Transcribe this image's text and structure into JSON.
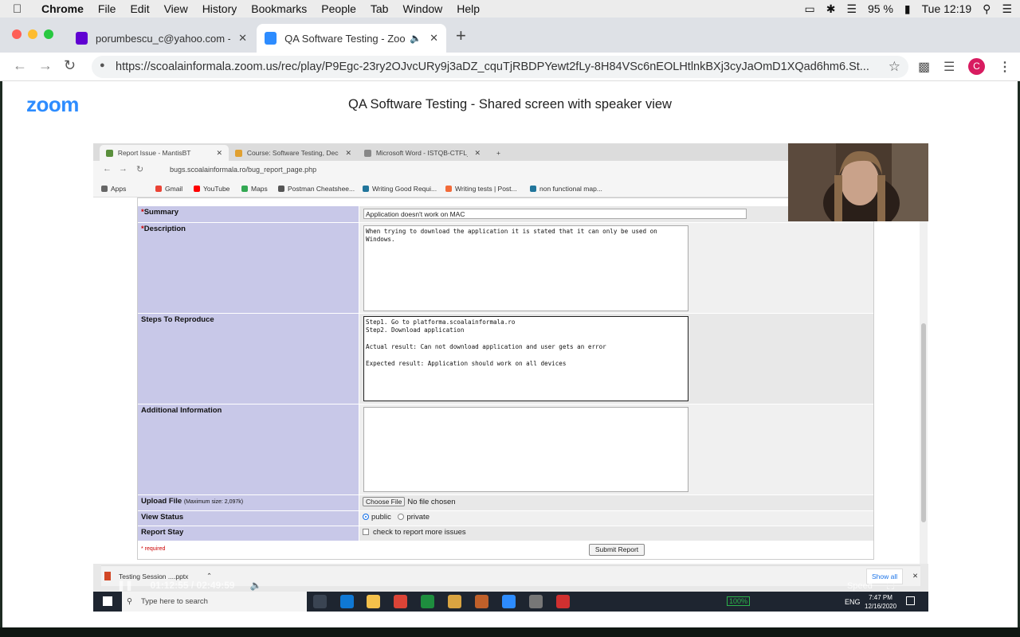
{
  "menubar": {
    "app": "Chrome",
    "items": [
      "File",
      "Edit",
      "View",
      "History",
      "Bookmarks",
      "People",
      "Tab",
      "Window",
      "Help"
    ],
    "battery": "95 %",
    "time": "Tue 12:19"
  },
  "browser": {
    "tabs": [
      {
        "title": "porumbescu_c@yahoo.com - Y",
        "fav_color": "#6001d2"
      },
      {
        "title": "QA Software Testing - Zoo",
        "fav_color": "#2d8cff"
      }
    ],
    "url": "https://scoalainformala.zoom.us/rec/play/P9Egc-23ry2OJvcURy9j3aDZ_cquTjRBDPYewt2fLy-8H84VSc6nEOLHtlnkBXj3cyJaOmD1XQad6hm6.St...",
    "profile_initial": "C"
  },
  "zoom": {
    "logo": "zoom",
    "title": "QA Software Testing - Shared screen with speaker view"
  },
  "recording": {
    "tabs": [
      {
        "title": "Report Issue - MantisBT"
      },
      {
        "title": "Course: Software Testing, Decem"
      },
      {
        "title": "Microsoft Word - ISTQB-CTFL_Sy"
      }
    ],
    "url": "bugs.scoalainformala.ro/bug_report_page.php",
    "bookmarks": [
      "Apps",
      "Gmail",
      "YouTube",
      "Maps",
      "Postman Cheatshee...",
      "Writing Good Requi...",
      "Writing tests | Post...",
      "non functional map..."
    ],
    "form": {
      "summary_label": "Summary",
      "summary_value": "Application doesn't work on MAC",
      "description_label": "Description",
      "description_value": "When trying to download the application it is stated that it can only be used on Windows.",
      "steps_label": "Steps To Reproduce",
      "steps_value": "Step1. Go to platforma.scoalainformala.ro\nStep2. Download application\n\nActual result: Can not download application and user gets an error\n\nExpected result: Application should work on all devices",
      "additional_label": "Additional Information",
      "upload_label": "Upload File",
      "upload_max": "(Maximum size: 2,097k)",
      "choose_file": "Choose File",
      "no_file": "No file chosen",
      "view_status_label": "View Status",
      "public": "public",
      "private": "private",
      "report_stay_label": "Report Stay",
      "report_stay_text": "check to report more issues",
      "required_note": "* required",
      "submit": "Submit Report"
    },
    "downloads": {
      "file": "Testing Session ....pptx",
      "show_all": "Show all"
    },
    "player": {
      "elapsed": "01:12:55",
      "total": "02:49:59",
      "speed": "Speed"
    },
    "taskbar": {
      "search": "Type here to search",
      "zoom_level": "100%",
      "lang": "ENG",
      "clock": "7:47 PM",
      "date": "12/16/2020"
    }
  }
}
